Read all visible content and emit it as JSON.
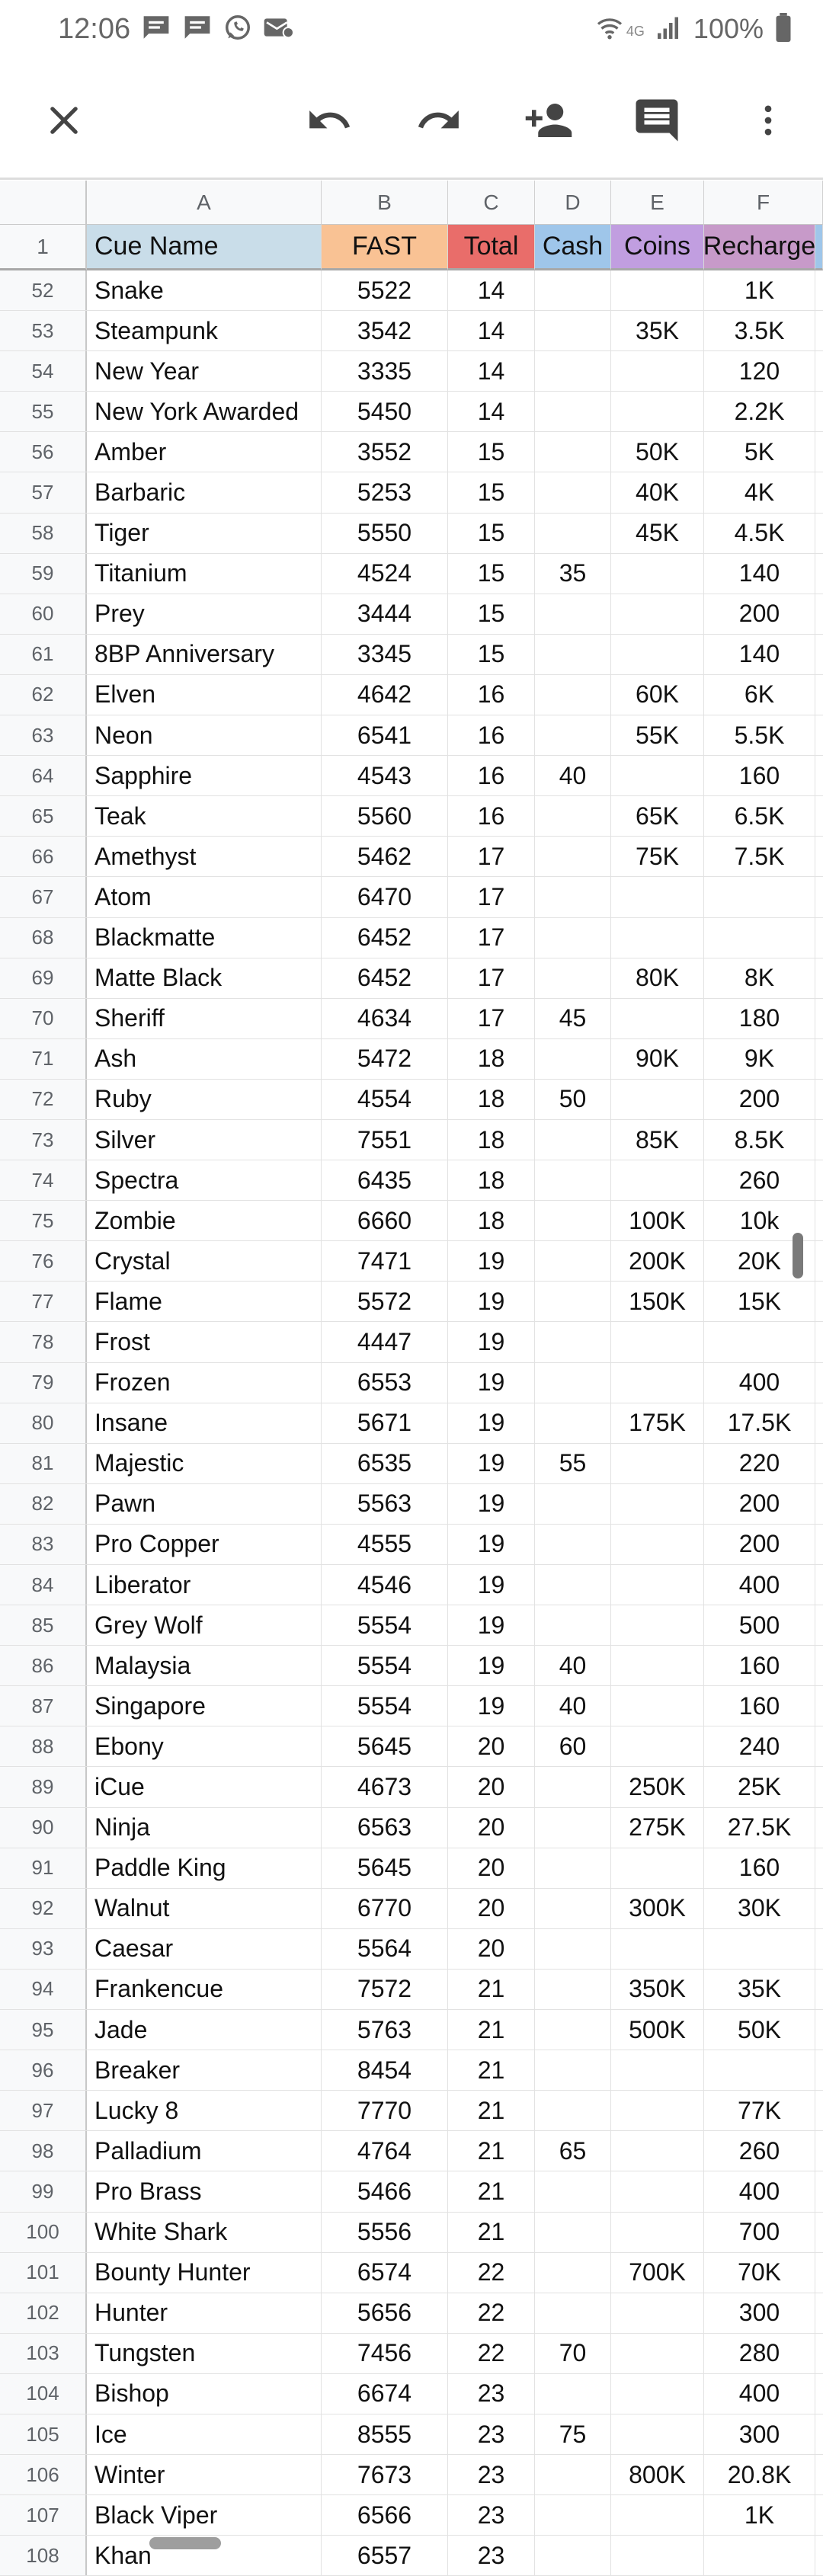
{
  "status_bar": {
    "time": "12:06",
    "battery": "100%",
    "network": "4G",
    "icons": [
      "message-icon",
      "message-icon",
      "whatsapp-icon",
      "notification-icon",
      "wifi-icon",
      "signal-icon",
      "battery-icon"
    ]
  },
  "toolbar": {
    "close_icon": "close-icon",
    "undo_icon": "undo-icon",
    "redo_icon": "redo-icon",
    "share_icon": "person-add-icon",
    "comment_icon": "comment-icon",
    "more_icon": "more-vert-icon"
  },
  "sheet": {
    "col_letters": [
      "A",
      "B",
      "C",
      "D",
      "E",
      "F"
    ],
    "header_row_num": "1",
    "headers": [
      "Cue Name",
      "FAST",
      "Total",
      "Cash",
      "Coins",
      "Recharge"
    ],
    "header_colors": {
      "A": "#c9dde9",
      "B": "#f9c294",
      "C": "#e96d6a",
      "D": "#9fc6ea",
      "E": "#c19ee0",
      "F": "#c79ac9"
    },
    "rows": [
      {
        "num": "52",
        "name": "Snake",
        "fast": "5522",
        "total": "14",
        "cash": "",
        "coins": "",
        "recharge": "1K"
      },
      {
        "num": "53",
        "name": "Steampunk",
        "fast": "3542",
        "total": "14",
        "cash": "",
        "coins": "35K",
        "recharge": "3.5K"
      },
      {
        "num": "54",
        "name": "New Year",
        "fast": "3335",
        "total": "14",
        "cash": "",
        "coins": "",
        "recharge": "120"
      },
      {
        "num": "55",
        "name": "New York Awarded",
        "fast": "5450",
        "total": "14",
        "cash": "",
        "coins": "",
        "recharge": "2.2K"
      },
      {
        "num": "56",
        "name": "Amber",
        "fast": "3552",
        "total": "15",
        "cash": "",
        "coins": "50K",
        "recharge": "5K"
      },
      {
        "num": "57",
        "name": "Barbaric",
        "fast": "5253",
        "total": "15",
        "cash": "",
        "coins": "40K",
        "recharge": "4K"
      },
      {
        "num": "58",
        "name": "Tiger",
        "fast": "5550",
        "total": "15",
        "cash": "",
        "coins": "45K",
        "recharge": "4.5K"
      },
      {
        "num": "59",
        "name": "Titanium",
        "fast": "4524",
        "total": "15",
        "cash": "35",
        "coins": "",
        "recharge": "140"
      },
      {
        "num": "60",
        "name": "Prey",
        "fast": "3444",
        "total": "15",
        "cash": "",
        "coins": "",
        "recharge": "200"
      },
      {
        "num": "61",
        "name": "8BP Anniversary",
        "fast": "3345",
        "total": "15",
        "cash": "",
        "coins": "",
        "recharge": "140"
      },
      {
        "num": "62",
        "name": "Elven",
        "fast": "4642",
        "total": "16",
        "cash": "",
        "coins": "60K",
        "recharge": "6K"
      },
      {
        "num": "63",
        "name": "Neon",
        "fast": "6541",
        "total": "16",
        "cash": "",
        "coins": "55K",
        "recharge": "5.5K"
      },
      {
        "num": "64",
        "name": "Sapphire",
        "fast": "4543",
        "total": "16",
        "cash": "40",
        "coins": "",
        "recharge": "160"
      },
      {
        "num": "65",
        "name": "Teak",
        "fast": "5560",
        "total": "16",
        "cash": "",
        "coins": "65K",
        "recharge": "6.5K"
      },
      {
        "num": "66",
        "name": "Amethyst",
        "fast": "5462",
        "total": "17",
        "cash": "",
        "coins": "75K",
        "recharge": "7.5K"
      },
      {
        "num": "67",
        "name": "Atom",
        "fast": "6470",
        "total": "17",
        "cash": "",
        "coins": "",
        "recharge": ""
      },
      {
        "num": "68",
        "name": "Blackmatte",
        "fast": "6452",
        "total": "17",
        "cash": "",
        "coins": "",
        "recharge": ""
      },
      {
        "num": "69",
        "name": "Matte Black",
        "fast": "6452",
        "total": "17",
        "cash": "",
        "coins": "80K",
        "recharge": "8K"
      },
      {
        "num": "70",
        "name": "Sheriff",
        "fast": "4634",
        "total": "17",
        "cash": "45",
        "coins": "",
        "recharge": "180"
      },
      {
        "num": "71",
        "name": "Ash",
        "fast": "5472",
        "total": "18",
        "cash": "",
        "coins": "90K",
        "recharge": "9K"
      },
      {
        "num": "72",
        "name": "Ruby",
        "fast": "4554",
        "total": "18",
        "cash": "50",
        "coins": "",
        "recharge": "200"
      },
      {
        "num": "73",
        "name": "Silver",
        "fast": "7551",
        "total": "18",
        "cash": "",
        "coins": "85K",
        "recharge": "8.5K"
      },
      {
        "num": "74",
        "name": "Spectra",
        "fast": "6435",
        "total": "18",
        "cash": "",
        "coins": "",
        "recharge": "260"
      },
      {
        "num": "75",
        "name": "Zombie",
        "fast": "6660",
        "total": "18",
        "cash": "",
        "coins": "100K",
        "recharge": "10k"
      },
      {
        "num": "76",
        "name": "Crystal",
        "fast": "7471",
        "total": "19",
        "cash": "",
        "coins": "200K",
        "recharge": "20K"
      },
      {
        "num": "77",
        "name": "Flame",
        "fast": "5572",
        "total": "19",
        "cash": "",
        "coins": "150K",
        "recharge": "15K"
      },
      {
        "num": "78",
        "name": "Frost",
        "fast": "4447",
        "total": "19",
        "cash": "",
        "coins": "",
        "recharge": ""
      },
      {
        "num": "79",
        "name": "Frozen",
        "fast": "6553",
        "total": "19",
        "cash": "",
        "coins": "",
        "recharge": "400"
      },
      {
        "num": "80",
        "name": "Insane",
        "fast": "5671",
        "total": "19",
        "cash": "",
        "coins": "175K",
        "recharge": "17.5K"
      },
      {
        "num": "81",
        "name": "Majestic",
        "fast": "6535",
        "total": "19",
        "cash": "55",
        "coins": "",
        "recharge": "220"
      },
      {
        "num": "82",
        "name": "Pawn",
        "fast": "5563",
        "total": "19",
        "cash": "",
        "coins": "",
        "recharge": "200"
      },
      {
        "num": "83",
        "name": "Pro Copper",
        "fast": "4555",
        "total": "19",
        "cash": "",
        "coins": "",
        "recharge": "200"
      },
      {
        "num": "84",
        "name": "Liberator",
        "fast": "4546",
        "total": "19",
        "cash": "",
        "coins": "",
        "recharge": "400"
      },
      {
        "num": "85",
        "name": "Grey Wolf",
        "fast": "5554",
        "total": "19",
        "cash": "",
        "coins": "",
        "recharge": "500"
      },
      {
        "num": "86",
        "name": "Malaysia",
        "fast": "5554",
        "total": "19",
        "cash": "40",
        "coins": "",
        "recharge": "160"
      },
      {
        "num": "87",
        "name": "Singapore",
        "fast": "5554",
        "total": "19",
        "cash": "40",
        "coins": "",
        "recharge": "160"
      },
      {
        "num": "88",
        "name": "Ebony",
        "fast": "5645",
        "total": "20",
        "cash": "60",
        "coins": "",
        "recharge": "240"
      },
      {
        "num": "89",
        "name": "iCue",
        "fast": "4673",
        "total": "20",
        "cash": "",
        "coins": "250K",
        "recharge": "25K"
      },
      {
        "num": "90",
        "name": "Ninja",
        "fast": "6563",
        "total": "20",
        "cash": "",
        "coins": "275K",
        "recharge": "27.5K"
      },
      {
        "num": "91",
        "name": "Paddle King",
        "fast": "5645",
        "total": "20",
        "cash": "",
        "coins": "",
        "recharge": "160"
      },
      {
        "num": "92",
        "name": "Walnut",
        "fast": "6770",
        "total": "20",
        "cash": "",
        "coins": "300K",
        "recharge": "30K"
      },
      {
        "num": "93",
        "name": "Caesar",
        "fast": "5564",
        "total": "20",
        "cash": "",
        "coins": "",
        "recharge": ""
      },
      {
        "num": "94",
        "name": "Frankencue",
        "fast": "7572",
        "total": "21",
        "cash": "",
        "coins": "350K",
        "recharge": "35K"
      },
      {
        "num": "95",
        "name": "Jade",
        "fast": "5763",
        "total": "21",
        "cash": "",
        "coins": "500K",
        "recharge": "50K"
      },
      {
        "num": "96",
        "name": "Breaker",
        "fast": "8454",
        "total": "21",
        "cash": "",
        "coins": "",
        "recharge": ""
      },
      {
        "num": "97",
        "name": "Lucky 8",
        "fast": "7770",
        "total": "21",
        "cash": "",
        "coins": "",
        "recharge": "77K"
      },
      {
        "num": "98",
        "name": "Palladium",
        "fast": "4764",
        "total": "21",
        "cash": "65",
        "coins": "",
        "recharge": "260"
      },
      {
        "num": "99",
        "name": "Pro Brass",
        "fast": "5466",
        "total": "21",
        "cash": "",
        "coins": "",
        "recharge": "400"
      },
      {
        "num": "100",
        "name": "White Shark",
        "fast": "5556",
        "total": "21",
        "cash": "",
        "coins": "",
        "recharge": "700"
      },
      {
        "num": "101",
        "name": "Bounty Hunter",
        "fast": "6574",
        "total": "22",
        "cash": "",
        "coins": "700K",
        "recharge": "70K"
      },
      {
        "num": "102",
        "name": "Hunter",
        "fast": "5656",
        "total": "22",
        "cash": "",
        "coins": "",
        "recharge": "300"
      },
      {
        "num": "103",
        "name": "Tungsten",
        "fast": "7456",
        "total": "22",
        "cash": "70",
        "coins": "",
        "recharge": "280"
      },
      {
        "num": "104",
        "name": "Bishop",
        "fast": "6674",
        "total": "23",
        "cash": "",
        "coins": "",
        "recharge": "400"
      },
      {
        "num": "105",
        "name": "Ice",
        "fast": "8555",
        "total": "23",
        "cash": "75",
        "coins": "",
        "recharge": "300"
      },
      {
        "num": "106",
        "name": "Winter",
        "fast": "7673",
        "total": "23",
        "cash": "",
        "coins": "800K",
        "recharge": "20.8K"
      },
      {
        "num": "107",
        "name": "Black Viper",
        "fast": "6566",
        "total": "23",
        "cash": "",
        "coins": "",
        "recharge": "1K"
      },
      {
        "num": "108",
        "name": "Khan",
        "fast": "6557",
        "total": "23",
        "cash": "",
        "coins": "",
        "recharge": ""
      }
    ]
  }
}
